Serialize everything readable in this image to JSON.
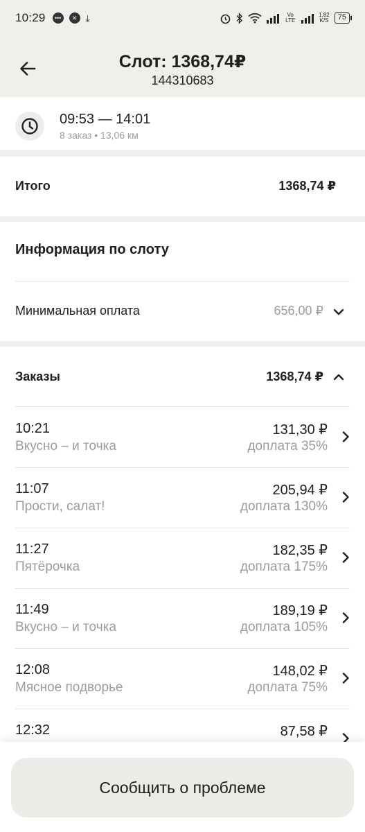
{
  "status_bar": {
    "time": "10:29",
    "signal_1": "Vo LTE",
    "speed_value": "1,82",
    "speed_unit": "K/S",
    "battery": "75"
  },
  "header": {
    "title": "Слот: 1368,74₽",
    "subtitle": "144310683"
  },
  "slot": {
    "time_range": "09:53 — 14:01",
    "meta": "8 заказ • 13,06 км"
  },
  "total": {
    "label": "Итого",
    "value": "1368,74 ₽"
  },
  "info": {
    "title": "Информация по слоту",
    "min_pay_label": "Минимальная оплата",
    "min_pay_value": "656,00 ₽"
  },
  "orders": {
    "label": "Заказы",
    "value": "1368,74 ₽",
    "items": [
      {
        "time": "10:21",
        "place": "Вкусно – и точка",
        "amount": "131,30 ₽",
        "extra": "доплата 35%"
      },
      {
        "time": "11:07",
        "place": "Прости, салат!",
        "amount": "205,94 ₽",
        "extra": "доплата 130%"
      },
      {
        "time": "11:27",
        "place": "Пятёрочка",
        "amount": "182,35 ₽",
        "extra": "доплата 175%"
      },
      {
        "time": "11:49",
        "place": "Вкусно – и точка",
        "amount": "189,19 ₽",
        "extra": "доплата 105%"
      },
      {
        "time": "12:08",
        "place": "Мясное подворье",
        "amount": "148,02 ₽",
        "extra": "доплата 75%"
      },
      {
        "time": "12:32",
        "place": "",
        "amount": "87,58 ₽",
        "extra": ""
      }
    ]
  },
  "action": {
    "report_problem": "Сообщить о проблеме"
  }
}
